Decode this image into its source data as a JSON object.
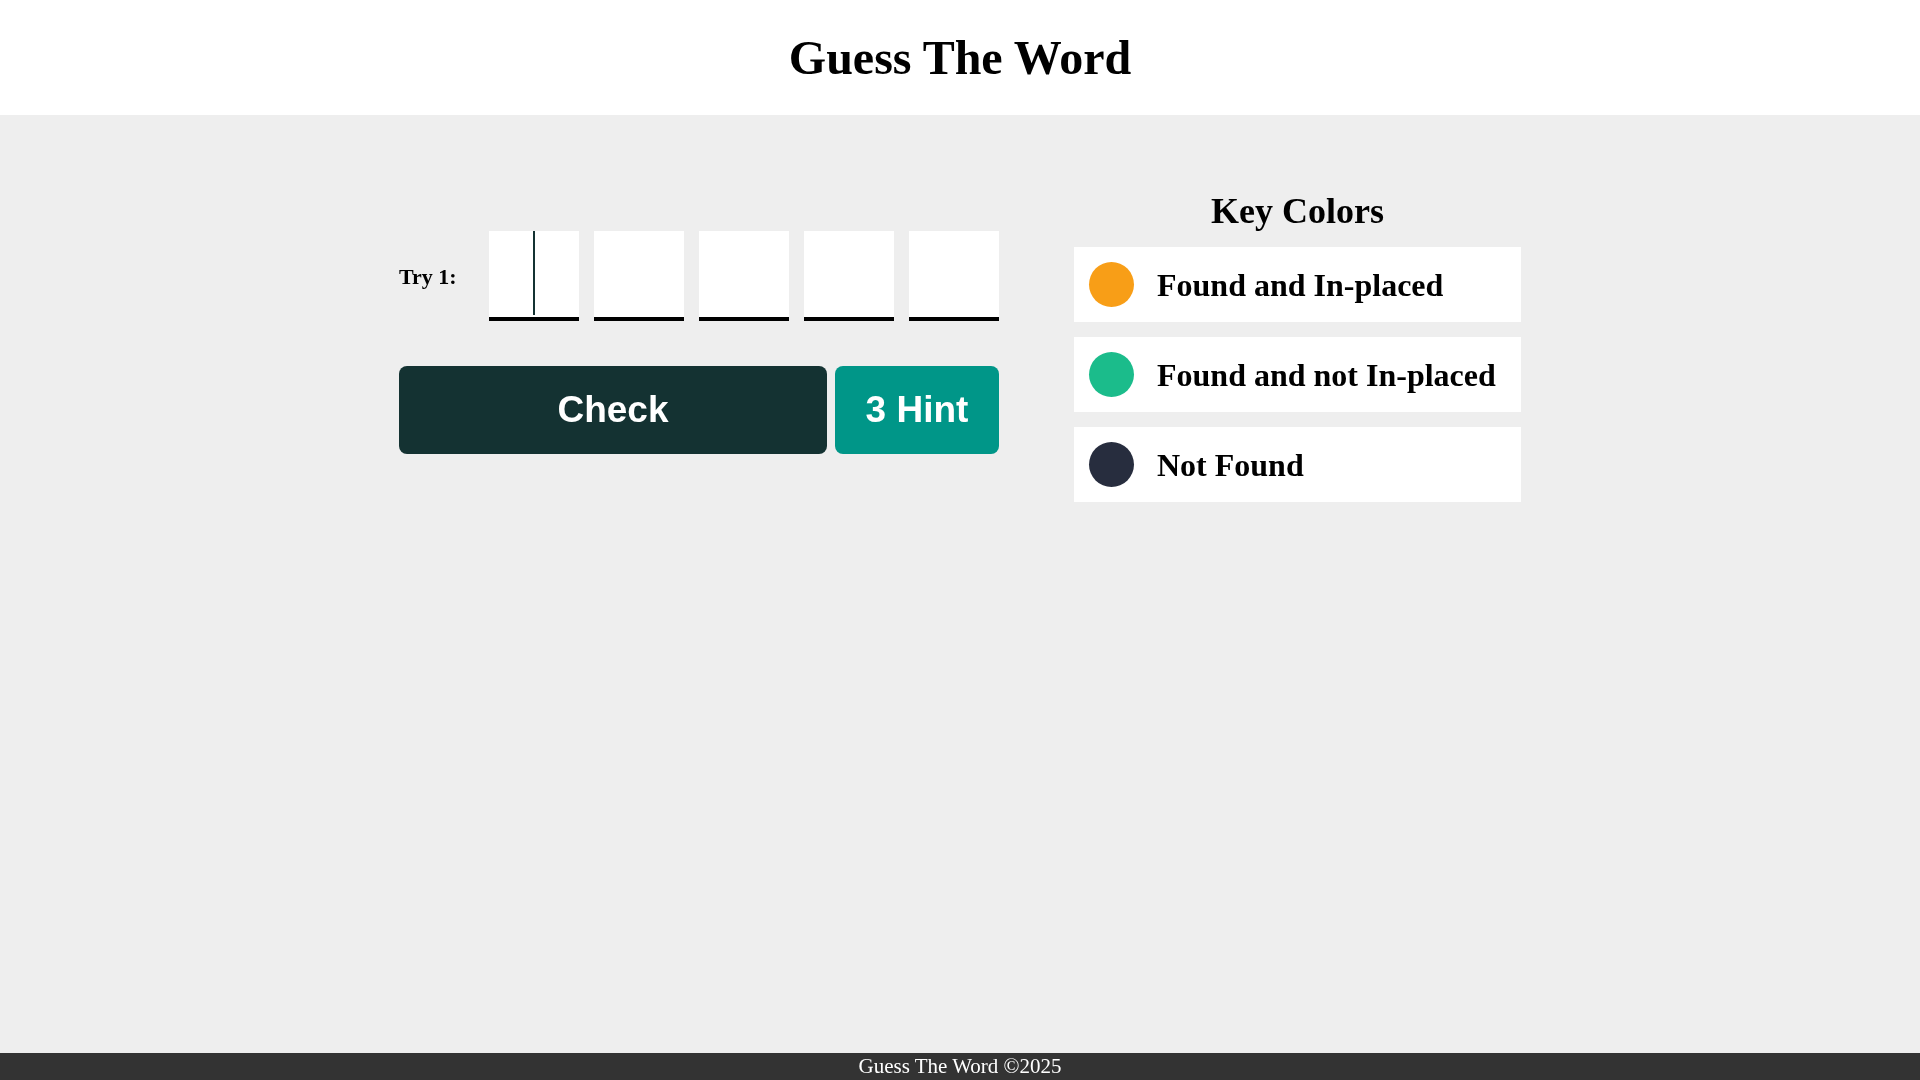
{
  "header": {
    "title": "Guess The Word"
  },
  "game": {
    "tries": [
      {
        "label": "Try 1:",
        "letters": [
          {
            "focused": true
          },
          {
            "focused": false
          },
          {
            "focused": false
          },
          {
            "focused": false
          },
          {
            "focused": false
          }
        ]
      }
    ],
    "buttons": [
      {
        "kind": "check",
        "label": "Check"
      },
      {
        "kind": "hint",
        "label": "3 Hint"
      }
    ]
  },
  "key_colors": {
    "title": "Key Colors",
    "items": [
      {
        "label": "Found and In-placed",
        "color": "#f89e17"
      },
      {
        "label": "Found and not In-placed",
        "color": "#1bbc8b"
      },
      {
        "label": "Not Found",
        "color": "#272d3e"
      }
    ]
  },
  "footer": {
    "text": "Guess The Word ©2025"
  }
}
